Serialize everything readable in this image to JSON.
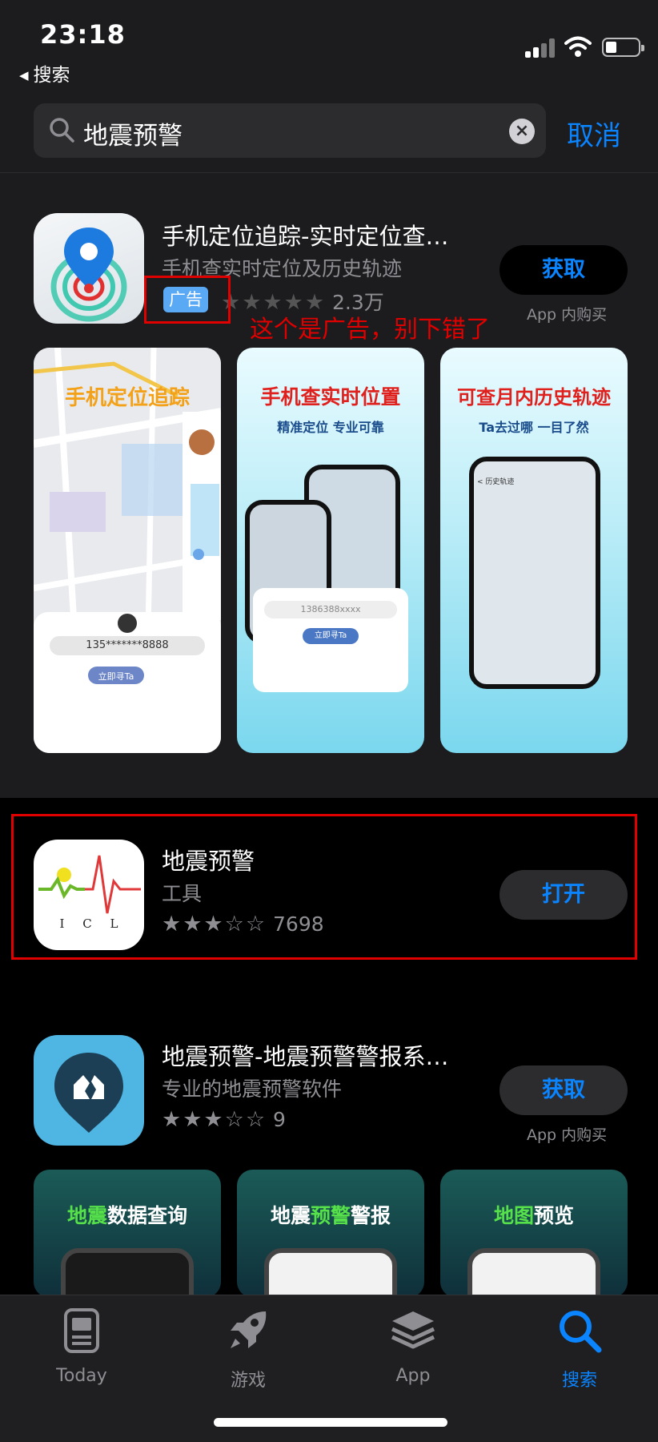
{
  "status_bar": {
    "time": "23:18",
    "back_label": "搜索"
  },
  "search": {
    "query": "地震预警",
    "cancel_label": "取消"
  },
  "ad_app": {
    "title": "手机定位追踪-实时定位查…",
    "subtitle": "手机查实时定位及历史轨迹",
    "badge": "广告",
    "rating_stars": 5,
    "rating_count": "2.3万",
    "button_label": "获取",
    "iap_label": "App 内购买",
    "annotation": "这个是广告，别下错了",
    "screenshots": [
      {
        "title": "手机定位追踪"
      },
      {
        "title": "手机查实时位置",
        "subtitle": "精准定位 专业可靠"
      },
      {
        "title": "可查月内历史轨迹",
        "subtitle": "Ta去过哪 一目了然"
      }
    ],
    "shot1": {
      "phone_number": "135*******8888",
      "button": "立即寻Ta"
    },
    "shot2": {
      "phone_number": "1386388xxxx",
      "button": "立即寻Ta"
    },
    "shot3": {
      "header": "< 历史轨迹"
    }
  },
  "result_app": {
    "title": "地震预警",
    "subtitle": "工具",
    "rating_stars": 3,
    "rating_count": "7698",
    "button_label": "打开",
    "icon_letters": "I C L"
  },
  "third_app": {
    "title": "地震预警-地震预警警报系…",
    "subtitle": "专业的地震预警软件",
    "rating_stars": 3,
    "rating_count": "9",
    "button_label": "获取",
    "iap_label": "App 内购买",
    "screenshots": [
      {
        "title_a": "地震",
        "title_b": "数据查询"
      },
      {
        "title_a": "地震",
        "title_b": "预警",
        "title_c": "警报"
      },
      {
        "title_a": "地图",
        "title_b": "预览"
      }
    ]
  },
  "tab_bar": {
    "tabs": [
      {
        "label": "Today",
        "icon": "today-icon"
      },
      {
        "label": "游戏",
        "icon": "rocket-icon"
      },
      {
        "label": "App",
        "icon": "layers-icon"
      },
      {
        "label": "搜索",
        "icon": "search-icon",
        "active": true
      }
    ]
  },
  "colors": {
    "accent": "#0a84ff",
    "annotation_red": "#e00000",
    "ad_badge": "#5aa9f5",
    "background": "#000000",
    "surface": "#1c1c1e"
  }
}
